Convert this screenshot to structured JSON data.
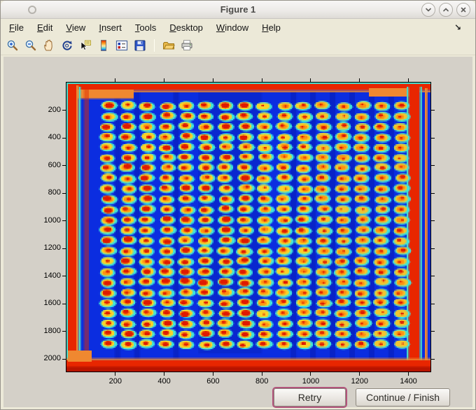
{
  "window": {
    "title": "Figure 1"
  },
  "titlebar": {
    "controls": [
      {
        "name": "minimize",
        "glyph": "chevron-down"
      },
      {
        "name": "maximize",
        "glyph": "chevron-up"
      },
      {
        "name": "close",
        "glyph": "x"
      }
    ]
  },
  "menu": {
    "items": [
      "File",
      "Edit",
      "View",
      "Insert",
      "Tools",
      "Desktop",
      "Window",
      "Help"
    ],
    "dock_arrow": "↘"
  },
  "toolbar": {
    "icons": [
      "zoom-in",
      "zoom-out",
      "pan",
      "rotate-3d",
      "data-cursor",
      "colorbar",
      "insert-legend",
      "save",
      "separator",
      "open-folder",
      "print"
    ]
  },
  "actions": {
    "retry": "Retry",
    "continue": "Continue / Finish"
  },
  "chart_data": {
    "type": "heatmap",
    "title": "",
    "xlabel": "",
    "ylabel": "",
    "x_range": [
      0,
      1490
    ],
    "y_range": [
      0,
      2090
    ],
    "y_direction": "reverse",
    "x_ticks": [
      200,
      400,
      600,
      800,
      1000,
      1200,
      1400
    ],
    "y_ticks": [
      200,
      400,
      600,
      800,
      1000,
      1200,
      1400,
      1600,
      1800,
      2000
    ],
    "grid": "off",
    "colormap": "jet",
    "description": "Scanned dot-blot / microarray plate rendered with a jet colormap: a 16 x 24 grid of bright spots (red-orange cores, yellow bodies, cyan halos) on a deep blue background, with saturated red-orange bands along all four image edges and a strong red vertical band near the right edge.",
    "spot_grid": {
      "cols": 16,
      "rows": 24,
      "x_first": 169,
      "x_spacing": 80,
      "y_first": 167,
      "y_spacing": 75
    },
    "colors": {
      "background": "#0b2de0",
      "background_dark": "#0620b4",
      "spot_halo": "#40e4d8",
      "spot_body": "#fad228",
      "spot_mid": "#ff9010",
      "spot_core": "#df1a00",
      "edge_red": "#e82600",
      "edge_dark_red": "#b81400",
      "edge_orange": "#ef8830",
      "edge_cyan": "#48d8c8"
    }
  }
}
